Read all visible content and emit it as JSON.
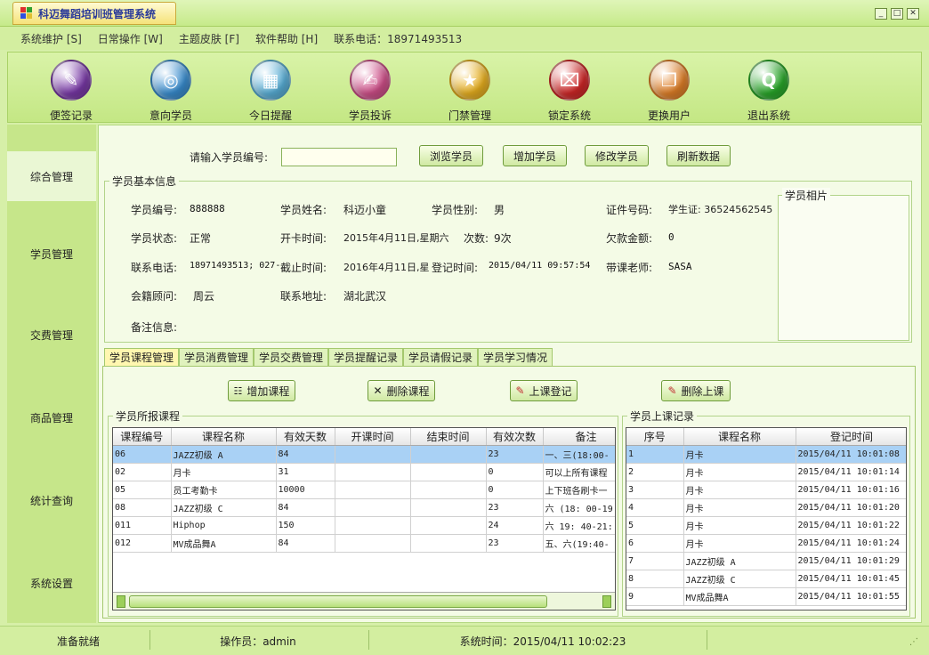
{
  "window": {
    "title": "科迈舞蹈培训班管理系统"
  },
  "menu": [
    "系统维护 [S]",
    "日常操作 [W]",
    "主题皮肤 [F]",
    "软件帮助 [H]",
    "联系电话：18971493513"
  ],
  "toolbar": [
    {
      "label": "便签记录",
      "icon": "note-icon",
      "color": "#7a3aa8"
    },
    {
      "label": "意向学员",
      "icon": "disc-icon",
      "color": "#3a8ed0"
    },
    {
      "label": "今日提醒",
      "icon": "calendar-icon",
      "color": "#5ab0d8"
    },
    {
      "label": "学员投诉",
      "icon": "notebook-icon",
      "color": "#d0508a"
    },
    {
      "label": "门禁管理",
      "icon": "star-icon",
      "color": "#e8b020"
    },
    {
      "label": "锁定系统",
      "icon": "lock-icon",
      "color": "#d02828"
    },
    {
      "label": "更换用户",
      "icon": "documents-icon",
      "color": "#e08028"
    },
    {
      "label": "退出系统",
      "icon": "quicktime-icon",
      "color": "#2aa82a"
    }
  ],
  "sidebar": [
    "综合管理",
    "学员管理",
    "交费管理",
    "商品管理",
    "统计查询",
    "系统设置"
  ],
  "search": {
    "label": "请输入学员编号:",
    "value": ""
  },
  "actions": [
    "浏览学员",
    "增加学员",
    "修改学员",
    "刷新数据"
  ],
  "info": {
    "group_title": "学员基本信息",
    "photo_title": "学员相片",
    "id_label": "学员编号:",
    "id": "888888",
    "name_label": "学员姓名:",
    "name": "科迈小童",
    "gender_label": "学员性别:",
    "gender": "男",
    "cert_label": "证件号码:",
    "cert": "学生证: 36524562545",
    "status_label": "学员状态:",
    "status": "正常",
    "start_label": "开卡时间:",
    "start": "2015年4月11日,星期六",
    "count_label": "次数:",
    "count": "9次",
    "debt_label": "欠款金额:",
    "debt": "0",
    "phone_label": "联系电话:",
    "phone": "18971493513; 027-",
    "end_label": "截止时间:",
    "end": "2016年4月11日,星",
    "reg_label": "登记时间:",
    "reg": "2015/04/11 09:57:54",
    "teacher_label": "带课老师:",
    "teacher": "SASA",
    "advisor_label": "会籍顾问:",
    "advisor": "周云",
    "addr_label": "联系地址:",
    "addr": "湖北武汉",
    "note_label": "备注信息:",
    "note": ""
  },
  "tabs": [
    "学员课程管理",
    "学员消费管理",
    "学员交费管理",
    "学员提醒记录",
    "学员请假记录",
    "学员学习情况"
  ],
  "course_actions": [
    "增加课程",
    "删除课程",
    "上课登记",
    "删除上课"
  ],
  "courses": {
    "title": "学员所报课程",
    "columns": [
      "课程编号",
      "课程名称",
      "有效天数",
      "开课时间",
      "结束时间",
      "有效次数",
      "备注"
    ],
    "rows": [
      [
        "06",
        "JAZZ初级  A",
        "84",
        "",
        "",
        "23",
        "一、三(18:00-"
      ],
      [
        "02",
        "月卡",
        "31",
        "",
        "",
        "0",
        "可以上所有课程"
      ],
      [
        "05",
        "员工考勤卡",
        "10000",
        "",
        "",
        "0",
        "上下班各刷卡一"
      ],
      [
        "08",
        "JAZZ初级  C",
        "84",
        "",
        "",
        "23",
        "六 (18: 00-19"
      ],
      [
        "011",
        "Hiphop",
        "150",
        "",
        "",
        "24",
        "六 19: 40-21:"
      ],
      [
        "012",
        "MV成品舞A",
        "84",
        "",
        "",
        "23",
        "五、六(19:40-"
      ]
    ]
  },
  "attendance": {
    "title": "学员上课记录",
    "columns": [
      "序号",
      "课程名称",
      "登记时间"
    ],
    "rows": [
      [
        "1",
        "月卡",
        "2015/04/11 10:01:08"
      ],
      [
        "2",
        "月卡",
        "2015/04/11 10:01:14"
      ],
      [
        "3",
        "月卡",
        "2015/04/11 10:01:16"
      ],
      [
        "4",
        "月卡",
        "2015/04/11 10:01:20"
      ],
      [
        "5",
        "月卡",
        "2015/04/11 10:01:22"
      ],
      [
        "6",
        "月卡",
        "2015/04/11 10:01:24"
      ],
      [
        "7",
        "JAZZ初级  A",
        "2015/04/11 10:01:29"
      ],
      [
        "8",
        "JAZZ初级  C",
        "2015/04/11 10:01:45"
      ],
      [
        "9",
        "MV成品舞A",
        "2015/04/11 10:01:55"
      ]
    ]
  },
  "status": {
    "ready": "准备就绪",
    "operator": "操作员：admin",
    "time": "系统时间：2015/04/11 10:02:23"
  }
}
